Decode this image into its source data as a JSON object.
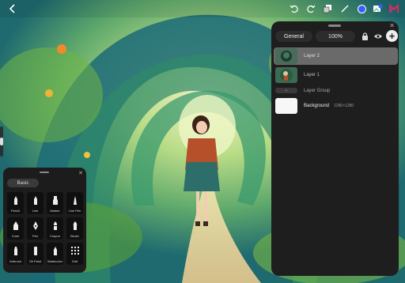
{
  "toolbar": {
    "back_icon": "chevron-left-icon",
    "undo_icon": "undo-icon",
    "redo_icon": "redo-icon",
    "layers_icon": "layers-icon",
    "brush_icon": "pen-icon",
    "color_swatch": "#2f63ff",
    "export_icon": "image-export-icon",
    "logo_icon": "app-logo-icon"
  },
  "layers_panel": {
    "blend_mode": "General",
    "opacity": "100%",
    "layers": [
      {
        "label": "Layer 2",
        "selected": true
      },
      {
        "label": "Layer 1",
        "selected": false
      },
      {
        "label": "Layer Group",
        "selected": false
      },
      {
        "label": "Background",
        "dims": "1280×1280",
        "selected": false
      }
    ]
  },
  "brush_panel": {
    "tab": "Basic",
    "brushes": [
      {
        "name": "Pencil",
        "icon": "pencil-icon"
      },
      {
        "name": "Line",
        "icon": "line-icon"
      },
      {
        "name": "Marker",
        "icon": "marker-icon"
      },
      {
        "name": "Line Pen",
        "icon": "line-pen-icon"
      },
      {
        "name": "Color",
        "icon": "color-brush-icon"
      },
      {
        "name": "Pen",
        "icon": "pen-nib-icon"
      },
      {
        "name": "Crayon",
        "icon": "crayon-icon"
      },
      {
        "name": "Brush",
        "icon": "brush-icon"
      },
      {
        "name": "Airbrush",
        "icon": "airbrush-icon"
      },
      {
        "name": "Oil Paint",
        "icon": "oil-paint-icon"
      },
      {
        "name": "Watercolor",
        "icon": "watercolor-icon"
      },
      {
        "name": "Grid",
        "icon": "grid-icon"
      }
    ]
  }
}
